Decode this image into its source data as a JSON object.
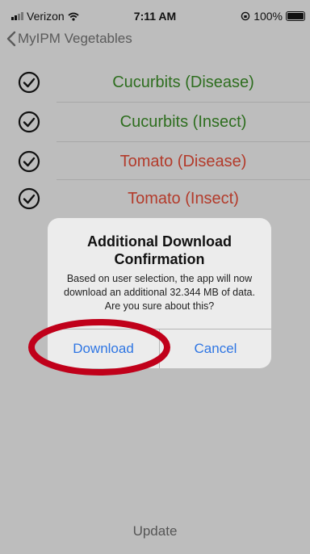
{
  "status_bar": {
    "carrier": "Verizon",
    "time": "7:11 AM",
    "battery": "100%"
  },
  "nav": {
    "back_label": "MyIPM Vegetables"
  },
  "list": [
    {
      "label": "Cucurbits (Disease)",
      "color": "#2e6e1f"
    },
    {
      "label": "Cucurbits (Insect)",
      "color": "#2e6e1f"
    },
    {
      "label": "Tomato (Disease)",
      "color": "#b33b2b"
    },
    {
      "label": "Tomato (Insect)",
      "color": "#b33b2b"
    }
  ],
  "dialog": {
    "title": "Additional Download Confirmation",
    "message": "Based on user selection, the app will now download an additional 32.344 MB of data. Are you sure about this?",
    "download_label": "Download",
    "cancel_label": "Cancel"
  },
  "footer": {
    "update_label": "Update"
  },
  "colors": {
    "accent": "#2f76e3",
    "highlight_ring": "#c0001a"
  }
}
